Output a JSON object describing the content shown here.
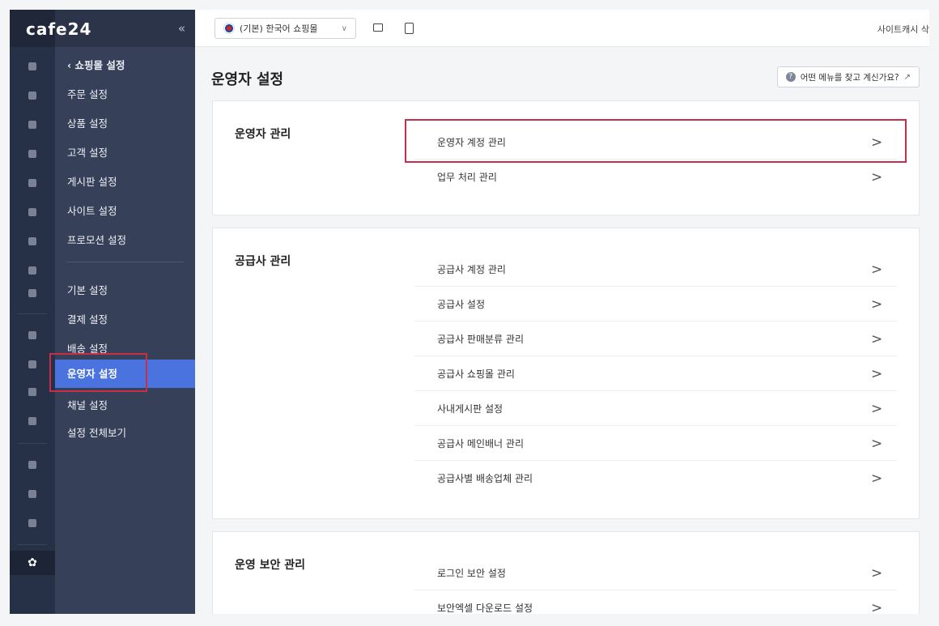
{
  "brand": {
    "logo": "cafe24",
    "collapse_icon": "«"
  },
  "sidebar": {
    "back_label": "‹ 쇼핑몰 설정",
    "items": [
      {
        "label": "주문 설정"
      },
      {
        "label": "상품 설정"
      },
      {
        "label": "고객 설정"
      },
      {
        "label": "게시판 설정"
      },
      {
        "label": "사이트 설정"
      },
      {
        "label": "프로모션 설정"
      },
      {
        "label": "기본 설정"
      },
      {
        "label": "결제 설정"
      },
      {
        "label": "배송 설정"
      },
      {
        "label": "운영자 설정",
        "active": true
      },
      {
        "label": "채널 설정"
      },
      {
        "label": "설정 전체보기"
      }
    ],
    "highlight_color": "#c62e4a",
    "active_color": "#4a73e0"
  },
  "topbar": {
    "store_select": "(기본) 한국어 쇼핑몰",
    "right_text": "사이트캐시 삭"
  },
  "page": {
    "title": "운영자 설정",
    "help_button": "어떤 메뉴를 찾고 계신가요?"
  },
  "sections": [
    {
      "title": "운영자 관리",
      "items": [
        "운영자 계정 관리",
        "업무 처리 관리"
      ]
    },
    {
      "title": "공급사 관리",
      "items": [
        "공급사 계정 관리",
        "공급사 설정",
        "공급사 판매분류 관리",
        "공급사 쇼핑몰 관리",
        "사내게시판 설정",
        "공급사 메인배너 관리",
        "공급사별 배송업체 관리"
      ]
    },
    {
      "title": "운영 보안 관리",
      "items": [
        "로그인 보안 설정",
        "보안엑셀 다운로드 설정"
      ]
    }
  ],
  "icons": [
    "home-icon",
    "cart-icon",
    "shirt-icon",
    "user-icon",
    "board-icon",
    "palette-icon",
    "coupon-icon",
    "chart-icon",
    "building-icon",
    "store-icon",
    "megaphone-icon",
    "monitor-icon",
    "truck-icon",
    "apps-icon",
    "folder-icon",
    "link-icon",
    "gear-icon",
    "chevron-right-icon",
    "desktop-icon",
    "mobile-icon",
    "external-link-icon",
    "question-icon"
  ]
}
